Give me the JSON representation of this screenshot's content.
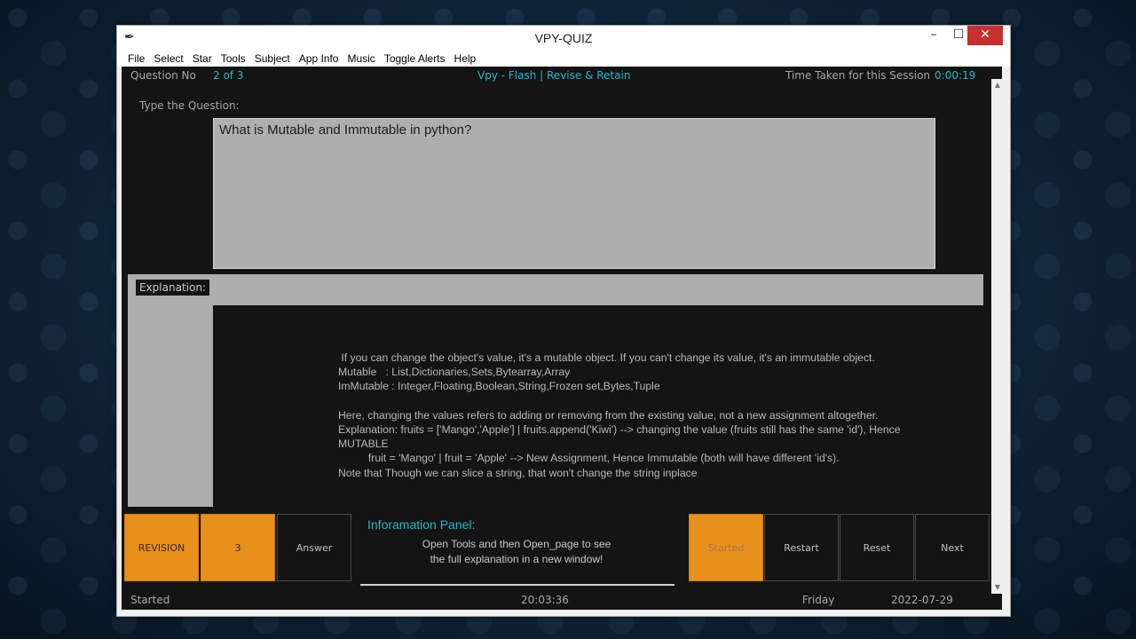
{
  "window": {
    "title": "VPY-QUIZ",
    "minimize": "–",
    "maximize": "☐",
    "close": "✕",
    "icon": "feather-icon"
  },
  "menu": [
    "File",
    "Select",
    "Star",
    "Tools",
    "Subject",
    "App Info",
    "Music",
    "Toggle Alerts",
    "Help"
  ],
  "header": {
    "question_no_label": "Question No",
    "question_no_value": "2 of 3",
    "app_tagline": "Vpy - Flash | Revise & Retain",
    "time_label": "Time Taken for this Session",
    "time_value": "0:00:19"
  },
  "question": {
    "label": "Type the Question:",
    "text": "What is Mutable and Immutable in python?"
  },
  "explanation": {
    "label": "Explanation:",
    "text": " If you can change the object's value, it's a mutable object. If you can't change its value, it's an immutable object.\nMutable   : List,Dictionaries,Sets,Bytearray,Array\nImMutable : Integer,Floating,Boolean,String,Frozen set,Bytes,Tuple\n\nHere, changing the values refers to adding or removing from the existing value, not a new assignment altogether.\nExplanation: fruits = ['Mango','Apple'] | fruits.append('Kiwi') --> changing the value (fruits still has the same 'id'), Hence\nMUTABLE\n          fruit = 'Mango' | fruit = 'Apple' --> New Assignment, Hence Immutable (both will have different 'id's).\nNote that Though we can slice a string, that won't change the string inplace"
  },
  "buttons": {
    "revision": "REVISION",
    "count": "3",
    "answer": "Answer",
    "started": "Started",
    "restart": "Restart",
    "reset": "Reset",
    "next": "Next"
  },
  "info_panel": {
    "title": "Inforamation Panel:",
    "message": "Open Tools and then Open_page  to see\nthe full explanation in a new window!"
  },
  "status": {
    "state": "Started",
    "time": "20:03:36",
    "day": "Friday",
    "date": "2022-07-29"
  },
  "colors": {
    "accent_orange": "#e8901c",
    "accent_cyan": "#22b9c8",
    "background": "#141414",
    "panel_grey": "#aeaeae"
  }
}
